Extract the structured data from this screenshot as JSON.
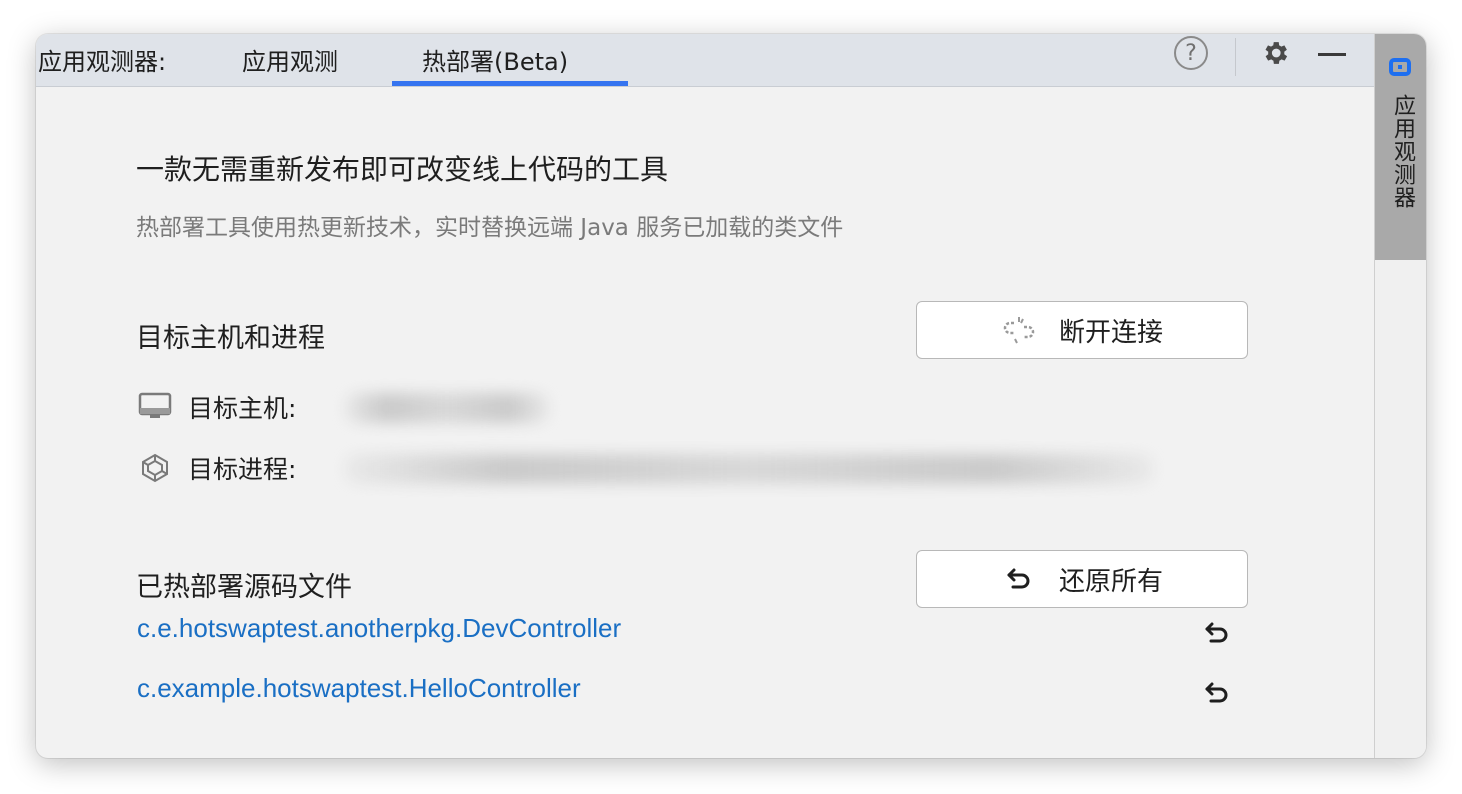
{
  "header": {
    "tool_title": "应用观测器:",
    "tabs": [
      {
        "label": "应用观测",
        "active": false
      },
      {
        "label": "热部署(Beta)",
        "active": true
      }
    ],
    "help_glyph": "?",
    "icons": [
      "help-icon",
      "gear-icon",
      "minimize-icon"
    ]
  },
  "stripe": {
    "label": "应用观测器",
    "accent_color": "#1e6ff0"
  },
  "main": {
    "title": "一款无需重新发布即可改变线上代码的工具",
    "subtitle": "热部署工具使用热更新技术，实时替换远端 Java 服务已加载的类文件"
  },
  "target": {
    "section_title": "目标主机和进程",
    "disconnect_label": "断开连接",
    "host_label": "目标主机:",
    "process_label": "目标进程:"
  },
  "files": {
    "section_title": "已热部署源码文件",
    "restore_all_label": "还原所有",
    "items": [
      "c.e.hotswaptest.anotherpkg.DevController",
      "c.example.hotswaptest.HelloController"
    ],
    "link_color": "#1a6fc4"
  },
  "colors": {
    "tab_underline": "#3574f0",
    "header_bg": "#dfe3e9",
    "panel_bg": "#f2f2f2"
  }
}
